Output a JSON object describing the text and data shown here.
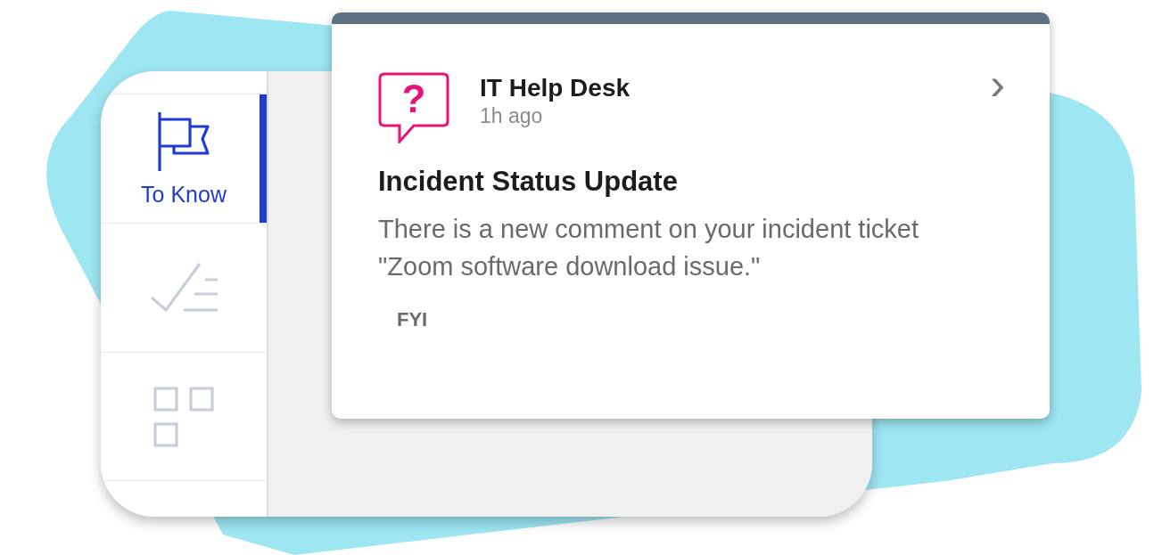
{
  "sidebar": {
    "items": [
      {
        "kind": "flag",
        "label": "To Know",
        "selected": true
      },
      {
        "kind": "checklist",
        "selected": false
      },
      {
        "kind": "grid",
        "selected": false
      }
    ]
  },
  "card": {
    "icon_glyph": "?",
    "source": "IT Help Desk",
    "time": "1h ago",
    "title": "Incident Status Update",
    "body": "There is a new comment on your incident ticket \"Zoom software download issue.\"",
    "tag": "FYI",
    "chevron": "›"
  }
}
